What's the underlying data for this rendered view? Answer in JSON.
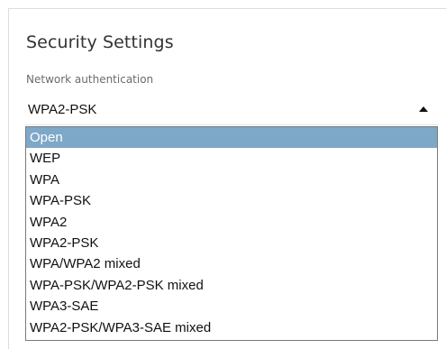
{
  "section": {
    "title": "Security Settings"
  },
  "auth": {
    "label": "Network authentication",
    "selected_value": "WPA2-PSK",
    "highlighted_option": "Open",
    "options": [
      "Open",
      "WEP",
      "WPA",
      "WPA-PSK",
      "WPA2",
      "WPA2-PSK",
      "WPA/WPA2 mixed",
      "WPA-PSK/WPA2-PSK mixed",
      "WPA3-SAE",
      "WPA2-PSK/WPA3-SAE mixed"
    ]
  },
  "icons": {
    "dropdown_caret": "caret-up-icon"
  },
  "colors": {
    "highlight": "#7ea8c8",
    "list_border": "#7a7a7a"
  }
}
